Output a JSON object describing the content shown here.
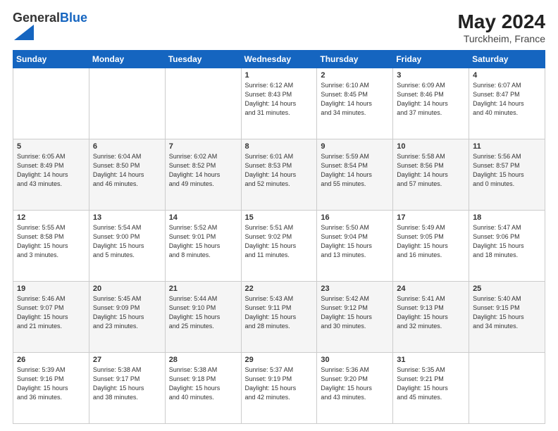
{
  "logo": {
    "general": "General",
    "blue": "Blue"
  },
  "title": {
    "month_year": "May 2024",
    "location": "Turckheim, France"
  },
  "weekdays": [
    "Sunday",
    "Monday",
    "Tuesday",
    "Wednesday",
    "Thursday",
    "Friday",
    "Saturday"
  ],
  "weeks": [
    [
      {
        "day": "",
        "info": ""
      },
      {
        "day": "",
        "info": ""
      },
      {
        "day": "",
        "info": ""
      },
      {
        "day": "1",
        "info": "Sunrise: 6:12 AM\nSunset: 8:43 PM\nDaylight: 14 hours\nand 31 minutes."
      },
      {
        "day": "2",
        "info": "Sunrise: 6:10 AM\nSunset: 8:45 PM\nDaylight: 14 hours\nand 34 minutes."
      },
      {
        "day": "3",
        "info": "Sunrise: 6:09 AM\nSunset: 8:46 PM\nDaylight: 14 hours\nand 37 minutes."
      },
      {
        "day": "4",
        "info": "Sunrise: 6:07 AM\nSunset: 8:47 PM\nDaylight: 14 hours\nand 40 minutes."
      }
    ],
    [
      {
        "day": "5",
        "info": "Sunrise: 6:05 AM\nSunset: 8:49 PM\nDaylight: 14 hours\nand 43 minutes."
      },
      {
        "day": "6",
        "info": "Sunrise: 6:04 AM\nSunset: 8:50 PM\nDaylight: 14 hours\nand 46 minutes."
      },
      {
        "day": "7",
        "info": "Sunrise: 6:02 AM\nSunset: 8:52 PM\nDaylight: 14 hours\nand 49 minutes."
      },
      {
        "day": "8",
        "info": "Sunrise: 6:01 AM\nSunset: 8:53 PM\nDaylight: 14 hours\nand 52 minutes."
      },
      {
        "day": "9",
        "info": "Sunrise: 5:59 AM\nSunset: 8:54 PM\nDaylight: 14 hours\nand 55 minutes."
      },
      {
        "day": "10",
        "info": "Sunrise: 5:58 AM\nSunset: 8:56 PM\nDaylight: 14 hours\nand 57 minutes."
      },
      {
        "day": "11",
        "info": "Sunrise: 5:56 AM\nSunset: 8:57 PM\nDaylight: 15 hours\nand 0 minutes."
      }
    ],
    [
      {
        "day": "12",
        "info": "Sunrise: 5:55 AM\nSunset: 8:58 PM\nDaylight: 15 hours\nand 3 minutes."
      },
      {
        "day": "13",
        "info": "Sunrise: 5:54 AM\nSunset: 9:00 PM\nDaylight: 15 hours\nand 5 minutes."
      },
      {
        "day": "14",
        "info": "Sunrise: 5:52 AM\nSunset: 9:01 PM\nDaylight: 15 hours\nand 8 minutes."
      },
      {
        "day": "15",
        "info": "Sunrise: 5:51 AM\nSunset: 9:02 PM\nDaylight: 15 hours\nand 11 minutes."
      },
      {
        "day": "16",
        "info": "Sunrise: 5:50 AM\nSunset: 9:04 PM\nDaylight: 15 hours\nand 13 minutes."
      },
      {
        "day": "17",
        "info": "Sunrise: 5:49 AM\nSunset: 9:05 PM\nDaylight: 15 hours\nand 16 minutes."
      },
      {
        "day": "18",
        "info": "Sunrise: 5:47 AM\nSunset: 9:06 PM\nDaylight: 15 hours\nand 18 minutes."
      }
    ],
    [
      {
        "day": "19",
        "info": "Sunrise: 5:46 AM\nSunset: 9:07 PM\nDaylight: 15 hours\nand 21 minutes."
      },
      {
        "day": "20",
        "info": "Sunrise: 5:45 AM\nSunset: 9:09 PM\nDaylight: 15 hours\nand 23 minutes."
      },
      {
        "day": "21",
        "info": "Sunrise: 5:44 AM\nSunset: 9:10 PM\nDaylight: 15 hours\nand 25 minutes."
      },
      {
        "day": "22",
        "info": "Sunrise: 5:43 AM\nSunset: 9:11 PM\nDaylight: 15 hours\nand 28 minutes."
      },
      {
        "day": "23",
        "info": "Sunrise: 5:42 AM\nSunset: 9:12 PM\nDaylight: 15 hours\nand 30 minutes."
      },
      {
        "day": "24",
        "info": "Sunrise: 5:41 AM\nSunset: 9:13 PM\nDaylight: 15 hours\nand 32 minutes."
      },
      {
        "day": "25",
        "info": "Sunrise: 5:40 AM\nSunset: 9:15 PM\nDaylight: 15 hours\nand 34 minutes."
      }
    ],
    [
      {
        "day": "26",
        "info": "Sunrise: 5:39 AM\nSunset: 9:16 PM\nDaylight: 15 hours\nand 36 minutes."
      },
      {
        "day": "27",
        "info": "Sunrise: 5:38 AM\nSunset: 9:17 PM\nDaylight: 15 hours\nand 38 minutes."
      },
      {
        "day": "28",
        "info": "Sunrise: 5:38 AM\nSunset: 9:18 PM\nDaylight: 15 hours\nand 40 minutes."
      },
      {
        "day": "29",
        "info": "Sunrise: 5:37 AM\nSunset: 9:19 PM\nDaylight: 15 hours\nand 42 minutes."
      },
      {
        "day": "30",
        "info": "Sunrise: 5:36 AM\nSunset: 9:20 PM\nDaylight: 15 hours\nand 43 minutes."
      },
      {
        "day": "31",
        "info": "Sunrise: 5:35 AM\nSunset: 9:21 PM\nDaylight: 15 hours\nand 45 minutes."
      },
      {
        "day": "",
        "info": ""
      }
    ]
  ]
}
